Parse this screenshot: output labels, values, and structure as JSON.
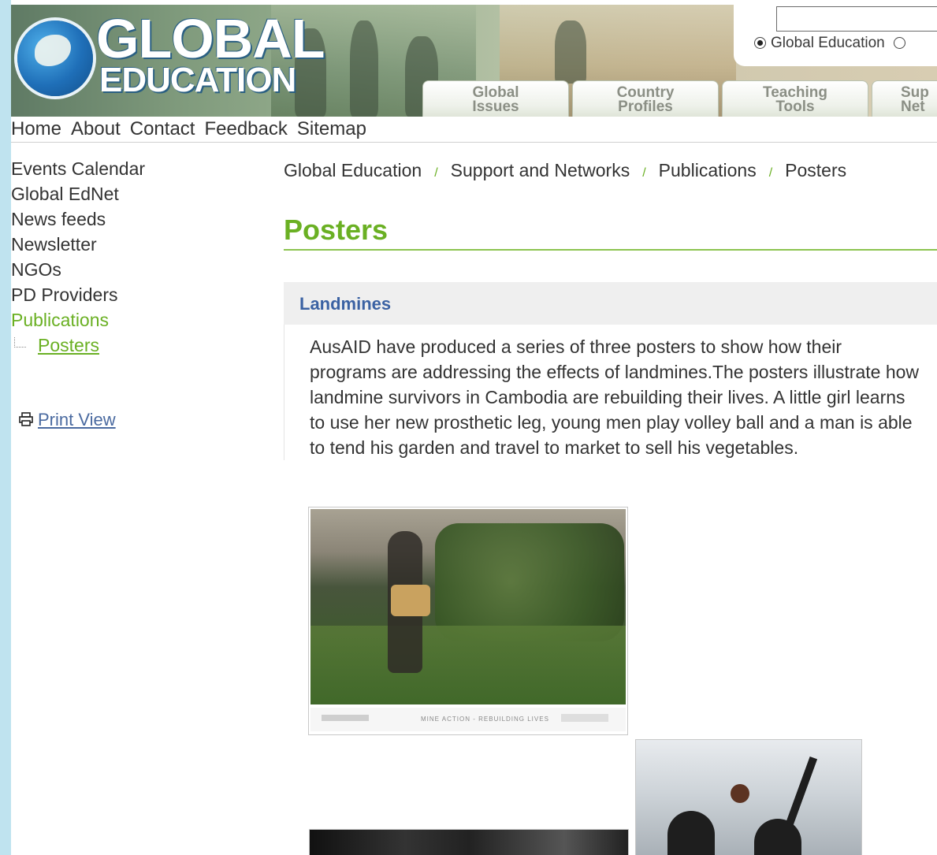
{
  "logo": {
    "line1": "GLOBAL",
    "line2": "EDUCATION"
  },
  "search": {
    "value": "",
    "radio_label": "Global Education",
    "radio_checked": true
  },
  "tabs": [
    {
      "line1": "Global",
      "line2": "Issues"
    },
    {
      "line1": "Country",
      "line2": "Profiles"
    },
    {
      "line1": "Teaching",
      "line2": "Tools"
    },
    {
      "line1": "Sup",
      "line2": "Net"
    }
  ],
  "topnav": [
    "Home",
    "About",
    "Contact",
    "Feedback",
    "Sitemap"
  ],
  "sidebar": {
    "items": [
      {
        "label": "Events Calendar"
      },
      {
        "label": "Global EdNet"
      },
      {
        "label": "News feeds"
      },
      {
        "label": "Newsletter"
      },
      {
        "label": "NGOs"
      },
      {
        "label": "PD Providers"
      },
      {
        "label": "Publications"
      }
    ],
    "sub_item": "Posters",
    "print_view": "Print View"
  },
  "breadcrumb": [
    "Global Education",
    "Support and Networks",
    "Publications",
    "Posters"
  ],
  "page_title": "Posters",
  "section": {
    "heading": "Landmines",
    "body": "AusAID have produced a series of three posters to show how their programs are addressing the effects of landmines.The posters illustrate how landmine survivors in Cambodia are rebuilding their lives. A little girl learns to use her new prosthetic leg, young men play volley ball and a man is able to tend his garden and travel to market to sell his vegetables."
  },
  "poster_strip_text": "MINE ACTION - REBUILDING LIVES",
  "colors": {
    "accent_green": "#6ab023",
    "link_blue": "#3b62a3",
    "page_bg": "#bfe3ef"
  }
}
